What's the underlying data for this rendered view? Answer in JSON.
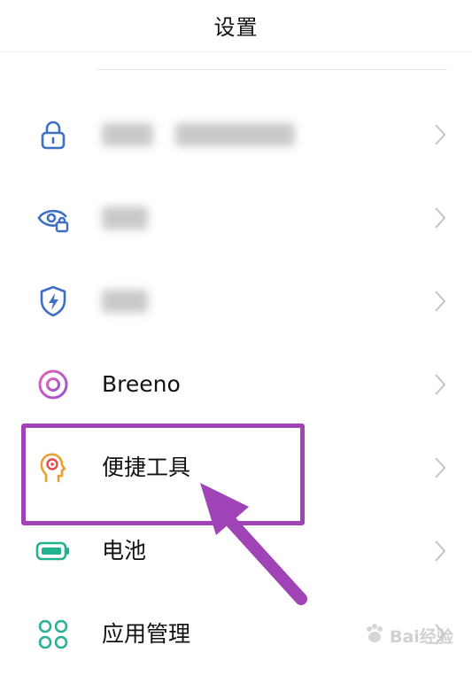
{
  "header": {
    "title": "设置"
  },
  "items": [
    {
      "label": "",
      "icon": "lock-icon",
      "blurred": true
    },
    {
      "label": "",
      "icon": "eye-lock-icon",
      "blurred": true
    },
    {
      "label": "",
      "icon": "shield-bolt-icon",
      "blurred": true
    },
    {
      "label": "Breeno",
      "icon": "breeno-icon"
    },
    {
      "label": "便捷工具",
      "icon": "head-target-icon"
    },
    {
      "label": "电池",
      "icon": "battery-icon"
    },
    {
      "label": "应用管理",
      "icon": "apps-grid-icon"
    }
  ],
  "colors": {
    "accent_blue": "#3f6fc4",
    "breeno_purple": "#c050c8",
    "tools_orange": "#e8a030",
    "battery_green": "#22b28f",
    "apps_green": "#2ab097",
    "annotation_purple": "#a043b6"
  },
  "watermark": {
    "text": "Bai经验"
  }
}
